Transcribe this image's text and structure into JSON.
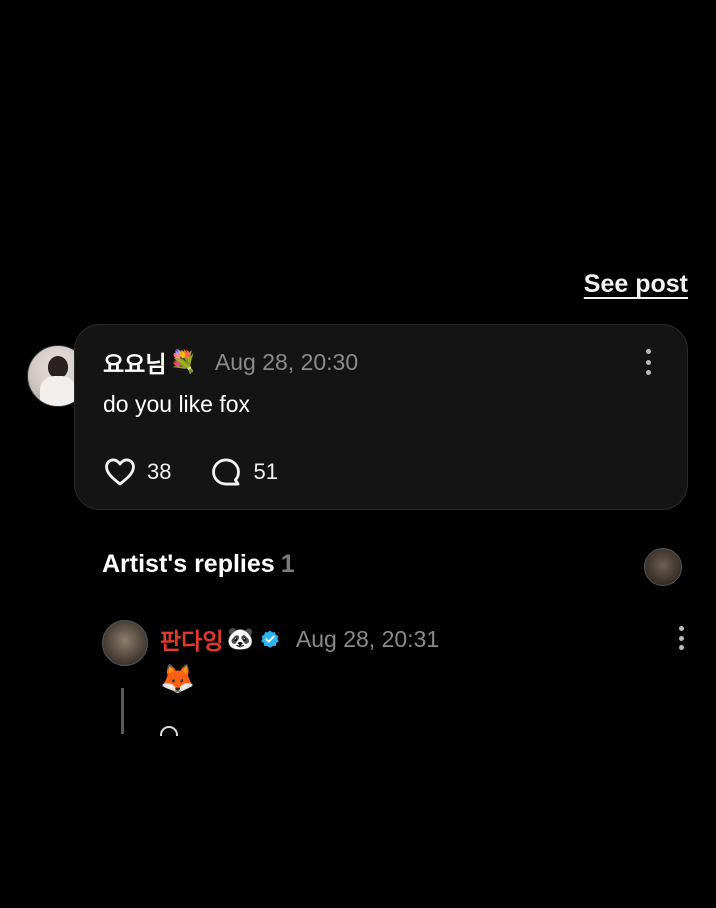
{
  "header": {
    "see_post_label": "See post"
  },
  "post": {
    "author": "요요님",
    "author_emoji": "💐",
    "time": "Aug 28, 20:30",
    "text": "do you like fox",
    "likes": "38",
    "comments": "51"
  },
  "replies": {
    "title": "Artist's replies",
    "count": "1",
    "items": [
      {
        "author": "판다잉",
        "author_emoji": "🐼",
        "verified": true,
        "time": "Aug 28, 20:31",
        "text": "🦊"
      }
    ]
  },
  "icons": {
    "like": "heart-icon",
    "comment": "comment-bubble-icon",
    "more": "more-vertical-icon",
    "verified": "verified-badge-icon"
  },
  "colors": {
    "background": "#000000",
    "card": "#141414",
    "reply_author": "#e0392e",
    "verified": "#29b6f6",
    "muted": "#8a8a8a"
  }
}
